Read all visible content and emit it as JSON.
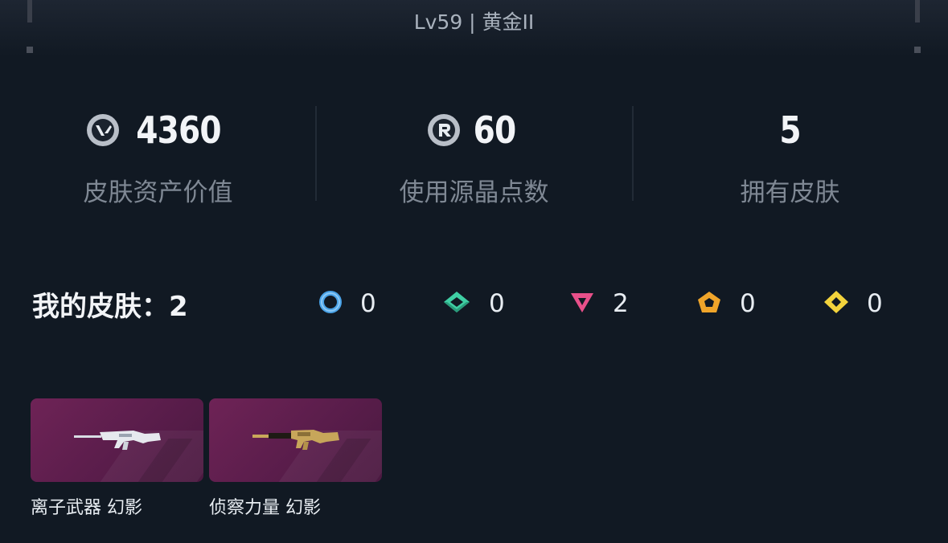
{
  "header": {
    "level_text": "Lv59 | 黄金II"
  },
  "stats": [
    {
      "value": "4360",
      "label": "皮肤资产价值",
      "icon": "valorant-points-icon"
    },
    {
      "value": "60",
      "label": "使用源晶点数",
      "icon": "radianite-points-icon"
    },
    {
      "value": "5",
      "label": "拥有皮肤",
      "icon": ""
    }
  ],
  "skins": {
    "title": "我的皮肤：",
    "count": "2",
    "tiers": [
      {
        "icon": "select-tier-icon",
        "color": "#4aa3e8",
        "count": "0"
      },
      {
        "icon": "deluxe-tier-icon",
        "color": "#3fcfa4",
        "count": "0"
      },
      {
        "icon": "premium-tier-icon",
        "color": "#e8508a",
        "count": "2"
      },
      {
        "icon": "exclusive-tier-icon",
        "color": "#f0a52a",
        "count": "0"
      },
      {
        "icon": "ultra-tier-icon",
        "color": "#f3d33c",
        "count": "0"
      }
    ],
    "items": [
      {
        "name": "离子武器 幻影",
        "image": "ion-phantom-image"
      },
      {
        "name": "侦察力量 幻影",
        "image": "recon-phantom-image"
      }
    ]
  },
  "colors": {
    "background": "#111923",
    "card_background": "#5e1f4e"
  }
}
